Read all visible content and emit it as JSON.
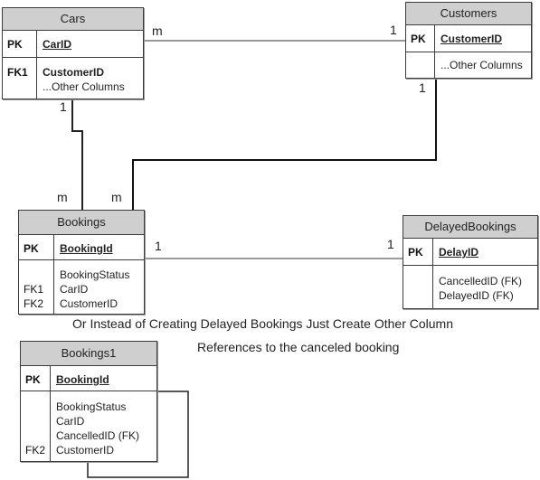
{
  "entities": {
    "cars": {
      "title": "Cars",
      "pk_label": "PK",
      "pk_column": "CarID",
      "key_labels": [
        "FK1"
      ],
      "columns": [
        "CustomerID",
        "...Other Columns"
      ]
    },
    "customers": {
      "title": "Customers",
      "pk_label": "PK",
      "pk_column": "CustomerID",
      "columns": [
        "...Other Columns"
      ]
    },
    "bookings": {
      "title": "Bookings",
      "pk_label": "PK",
      "pk_column": "BookingId",
      "key_labels": [
        "",
        "FK1",
        "FK2"
      ],
      "columns": [
        "BookingStatus",
        "CarID",
        "CustomerID"
      ]
    },
    "delayed_bookings": {
      "title": "DelayedBookings",
      "pk_label": "PK",
      "pk_column": "DelayID",
      "columns": [
        "CancelledID (FK)",
        "DelayedID (FK)"
      ]
    },
    "bookings1": {
      "title": "Bookings1",
      "pk_label": "PK",
      "pk_column": "BookingId",
      "key_labels": [
        "",
        "",
        "",
        "FK2"
      ],
      "columns": [
        "BookingStatus",
        "CarID",
        "CancelledID (FK)",
        "CustomerID"
      ]
    }
  },
  "relationships": [
    {
      "from": "Cars",
      "to": "Customers",
      "from_card": "m",
      "to_card": "1"
    },
    {
      "from": "Cars",
      "to": "Bookings",
      "from_card": "1",
      "to_card": "m"
    },
    {
      "from": "Customers",
      "to": "Bookings",
      "from_card": "1",
      "to_card": "m"
    },
    {
      "from": "Bookings",
      "to": "DelayedBookings",
      "from_card": "1",
      "to_card": "1"
    },
    {
      "from": "Bookings1",
      "to": "Bookings1",
      "type": "self-reference"
    }
  ],
  "notes": {
    "line1": "Or Instead of Creating Delayed Bookings Just Create Other Column",
    "line2": "References to the canceled booking"
  }
}
